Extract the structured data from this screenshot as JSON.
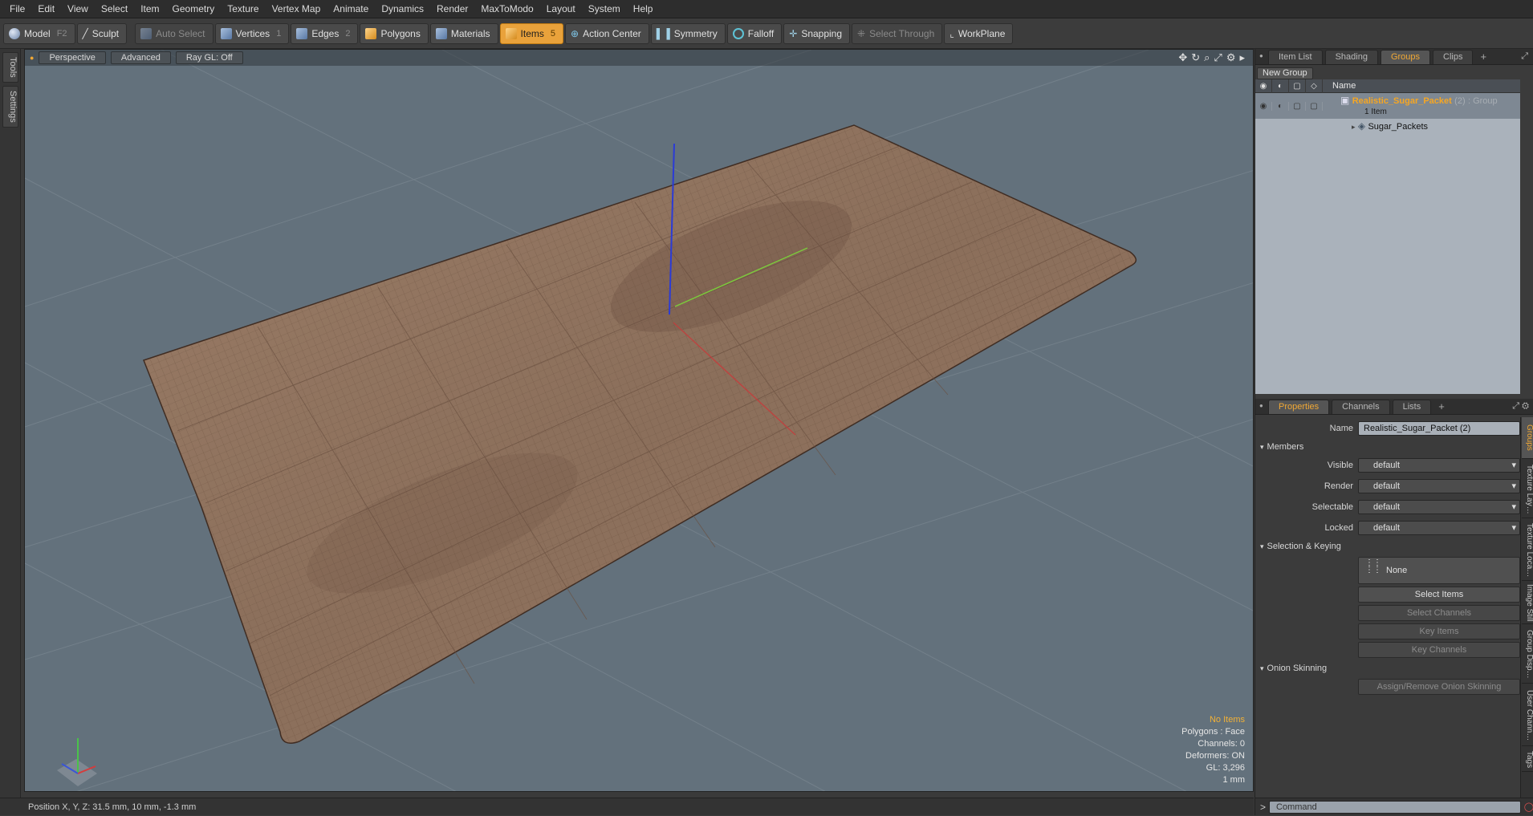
{
  "menu": [
    "File",
    "Edit",
    "View",
    "Select",
    "Item",
    "Geometry",
    "Texture",
    "Vertex Map",
    "Animate",
    "Dynamics",
    "Render",
    "MaxToModo",
    "Layout",
    "System",
    "Help"
  ],
  "toolbar": {
    "model": "Model",
    "model_key": "F2",
    "sculpt": "Sculpt",
    "auto_select": "Auto Select",
    "vertices": "Vertices",
    "vertices_key": "1",
    "edges": "Edges",
    "edges_key": "2",
    "polygons": "Polygons",
    "materials": "Materials",
    "items": "Items",
    "items_key": "5",
    "action_center": "Action Center",
    "symmetry": "Symmetry",
    "falloff": "Falloff",
    "snapping": "Snapping",
    "select_through": "Select Through",
    "workplane": "WorkPlane"
  },
  "left_tabs": [
    "Tools",
    "Settings"
  ],
  "viewport": {
    "view": "Perspective",
    "shading": "Advanced",
    "raygl": "Ray GL: Off",
    "info": {
      "selection": "No Items",
      "polygons": "Polygons : Face",
      "channels": "Channels: 0",
      "deformers": "Deformers: ON",
      "gl": "GL: 3,296",
      "unit": "1 mm"
    }
  },
  "status": {
    "position": "Position X, Y, Z:   31.5 mm, 10 mm, -1.3 mm"
  },
  "right_top_tabs": {
    "item_list": "Item List",
    "shading": "Shading",
    "groups": "Groups",
    "clips": "Clips",
    "plus": "+"
  },
  "groups": {
    "new_group": "New Group",
    "col_name": "Name",
    "group_name": "Realistic_Sugar_Packet",
    "group_count": "(2)",
    "group_type": ": Group",
    "group_sub": "1 Item",
    "child": "Sugar_Packets"
  },
  "props_tabs": {
    "properties": "Properties",
    "channels": "Channels",
    "lists": "Lists",
    "plus": "+"
  },
  "properties": {
    "name_label": "Name",
    "name_value": "Realistic_Sugar_Packet (2)",
    "members_header": "Members",
    "visible_label": "Visible",
    "visible_value": "default",
    "render_label": "Render",
    "render_value": "default",
    "selectable_label": "Selectable",
    "selectable_value": "default",
    "locked_label": "Locked",
    "locked_value": "default",
    "selkey_header": "Selection & Keying",
    "none_btn": "None",
    "select_items": "Select Items",
    "select_channels": "Select Channels",
    "key_items": "Key Items",
    "key_channels": "Key Channels",
    "onion_header": "Onion Skinning",
    "onion_btn": "Assign/Remove Onion Skinning"
  },
  "right_vtabs": [
    "Groups",
    "Texture Lay…",
    "Texture Loca…",
    "Image Still",
    "Group Disp…",
    "User Chann…",
    "Tags"
  ],
  "command": {
    "placeholder": "Command",
    "prompt": ">"
  },
  "colors": {
    "accent": "#e9a23b",
    "viewport_bg": "#63717c",
    "packet": "#8a6e58"
  }
}
